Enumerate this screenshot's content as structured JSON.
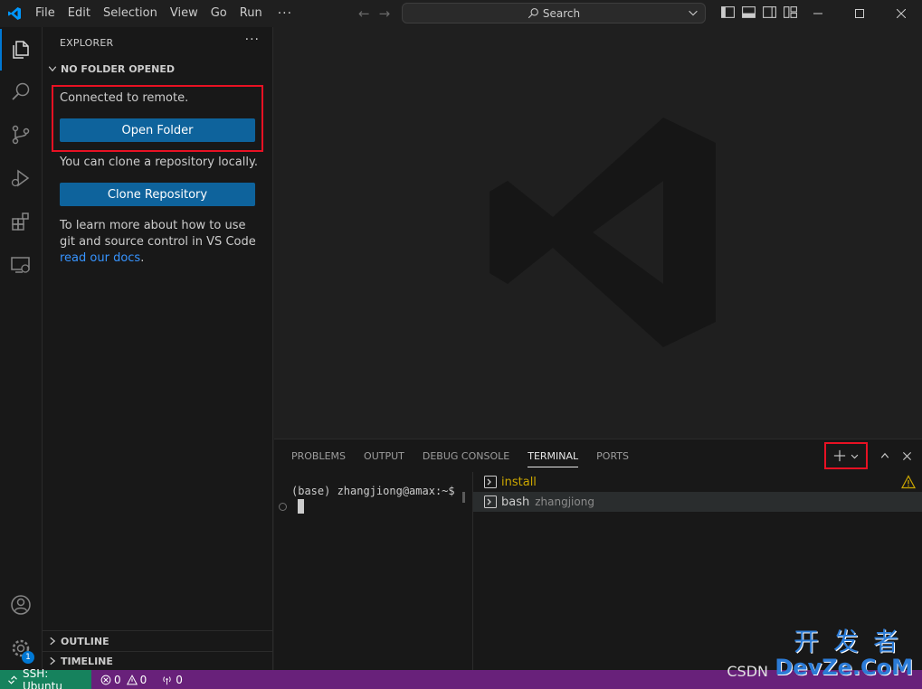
{
  "titlebar": {
    "menu": [
      "File",
      "Edit",
      "Selection",
      "View",
      "Go",
      "Run"
    ],
    "more": "···",
    "search_label": "Search"
  },
  "activitybar": {
    "items": [
      "explorer-icon",
      "search-icon",
      "source-control-icon",
      "run-debug-icon",
      "extensions-icon",
      "remote-explorer-icon"
    ],
    "bottom": [
      "account-icon",
      "settings-gear-icon"
    ],
    "settings_badge": "1"
  },
  "sidebar": {
    "header": "EXPLORER",
    "more": "···",
    "section": "NO FOLDER OPENED",
    "connected_text": "Connected to remote.",
    "open_folder_label": "Open Folder",
    "clone_text": "You can clone a repository locally.",
    "clone_label": "Clone Repository",
    "learn_text": "To learn more about how to use git and source control in VS Code ",
    "learn_link": "read our docs",
    "learn_end": ".",
    "outline": "OUTLINE",
    "timeline": "TIMELINE"
  },
  "panel": {
    "tabs": [
      "PROBLEMS",
      "OUTPUT",
      "DEBUG CONSOLE",
      "TERMINAL",
      "PORTS"
    ],
    "active_tab": "TERMINAL",
    "prompt": "(base) zhangjiong@amax:~$",
    "terminals": [
      {
        "name": "install",
        "desc": "",
        "color": "#cca700"
      },
      {
        "name": "bash",
        "desc": "zhangjiong",
        "color": "#cccccc"
      }
    ]
  },
  "statusbar": {
    "remote": "SSH: Ubuntu",
    "errors": "0",
    "warnings": "0",
    "ports": "0"
  },
  "watermark": {
    "cn": "开发者",
    "en": "DevZe.CoM",
    "csdn": "CSDN"
  },
  "colors": {
    "accent": "#0078d4",
    "button": "#0e639c",
    "statusbar": "#68217a",
    "remote": "#16825d",
    "highlight": "#e81123",
    "warning": "#cca700"
  }
}
